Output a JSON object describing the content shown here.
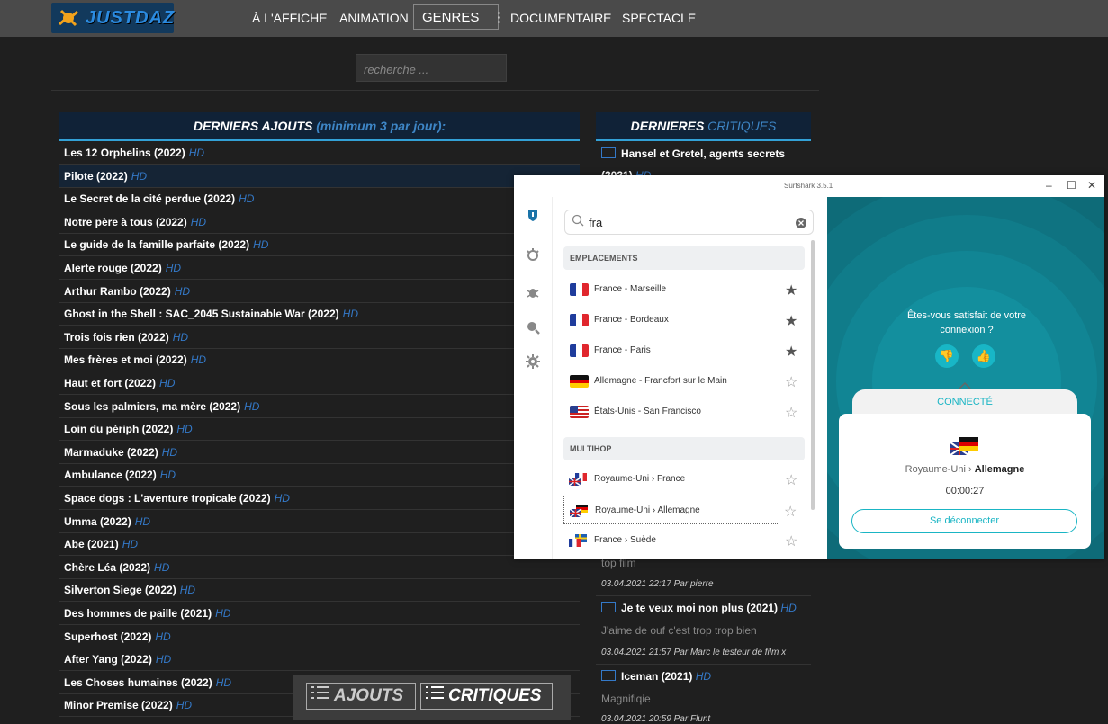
{
  "site": {
    "logo": "JUSTDAZ",
    "nav": [
      "À L'AFFICHE",
      "ANIMATION",
      "GENRES",
      "DOCUMENTAIRE",
      "SPECTACLE"
    ],
    "search_placeholder": "recherche ..."
  },
  "ajouts": {
    "title_main": "DERNIERS AJOUTS",
    "title_sub": "(minimum 3 par jour):",
    "hd_label": "HD",
    "films": [
      "Les 12 Orphelins (2022)",
      "Pilote (2022)",
      "Le Secret de la cité perdue (2022)",
      "Notre père à tous (2022)",
      "Le guide de la famille parfaite (2022)",
      "Alerte rouge (2022)",
      "Arthur Rambo (2022)",
      "Ghost in the Shell : SAC_2045 Sustainable War (2022)",
      "Trois fois rien (2022)",
      "Mes frères et moi (2022)",
      "Haut et fort (2022)",
      "Sous les palmiers, ma mère (2022)",
      "Loin du périph (2022)",
      "Marmaduke (2022)",
      "Ambulance (2022)",
      "Space dogs : L'aventure tropicale (2022)",
      "Umma (2022)",
      "Abe (2021)",
      "Chère Léa (2022)",
      "Silverton Siege (2022)",
      "Des hommes de paille (2021)",
      "Superhost (2022)",
      "After Yang (2022)",
      "Les Choses humaines (2022)",
      "Minor Premise (2022)"
    ]
  },
  "critiques": {
    "title_main": "DERNIERES",
    "title_sub": "CRITIQUES",
    "first_title": "Hansel et Gretel, agents secrets",
    "first_partial": "(2021)",
    "partial_text": "top film",
    "meta1": "03.04.2021 22:17 Par pierre",
    "c2_title": "Je te veux moi non plus (2021)",
    "c2_text": "J'aime de ouf c'est trop trop bien",
    "meta2": "03.04.2021 21:57 Par Marc le testeur de film x",
    "c3_title": "Iceman (2021)",
    "c3_text": "Magnifiqie",
    "meta3": "03.04.2021 20:59 Par Flunt"
  },
  "bottom": {
    "ajouts_label": "AJOUTS",
    "critiques_label": "CRITIQUES"
  },
  "vpn": {
    "window_title": "Surfshark 3.5.1",
    "search_value": "fra",
    "section_locations": "EMPLACEMENTS",
    "locations": [
      {
        "name": "France - Marseille",
        "fav": true
      },
      {
        "name": "France - Bordeaux",
        "fav": true
      },
      {
        "name": "France - Paris",
        "fav": true
      },
      {
        "name": "Allemagne - Francfort sur le Main",
        "fav": false
      },
      {
        "name": "États-Unis - San Francisco",
        "fav": false
      }
    ],
    "section_multihop": "MULTIHOP",
    "multihop": [
      {
        "name": "Royaume-Uni › France",
        "fav": false
      },
      {
        "name": "Royaume-Uni › Allemagne",
        "fav": false
      },
      {
        "name": "France › Suède",
        "fav": false
      }
    ],
    "satisfaction": "Êtes-vous satisfait de votre connexion ?",
    "status": "CONNECTÉ",
    "route_from": "Royaume-Uni",
    "route_sep": "›",
    "route_to": "Allemagne",
    "timer": "00:00:27",
    "disconnect": "Se déconnecter",
    "accent": "#1ab5c4",
    "panel_bg": "#0e6b78"
  }
}
